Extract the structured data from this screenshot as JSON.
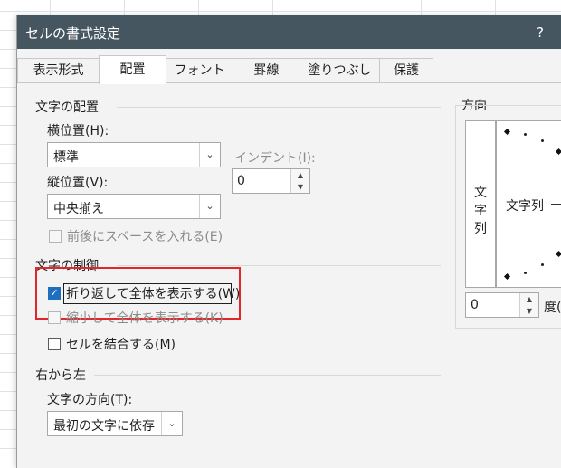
{
  "dialog": {
    "title": "セルの書式設定",
    "help": "?"
  },
  "tabs": [
    "表示形式",
    "配置",
    "フォント",
    "罫線",
    "塗りつぶし",
    "保護"
  ],
  "active_tab": "配置",
  "alignment": {
    "group_title": "文字の配置",
    "horizontal_label": "横位置(H):",
    "horizontal_value": "標準",
    "vertical_label": "縦位置(V):",
    "vertical_value": "中央揃え",
    "indent_label": "インデント(I):",
    "indent_value": "0",
    "justify_distributed": "前後にスペースを入れる(E)"
  },
  "text_control": {
    "group_title": "文字の制御",
    "wrap_text": "折り返して全体を表示する(W)",
    "wrap_text_checked": true,
    "shrink_to_fit": "縮小して全体を表示する(K)",
    "shrink_to_fit_checked": false,
    "merge_cells": "セルを結合する(M)",
    "merge_cells_checked": false
  },
  "rtl": {
    "group_title": "右から左",
    "direction_label": "文字の方向(T):",
    "direction_value": "最初の文字に依存"
  },
  "orientation": {
    "group_title": "方向",
    "vertical_text": [
      "文",
      "字",
      "列"
    ],
    "horizontal_text": "文字列",
    "degrees_value": "0",
    "degrees_unit": "度(D)"
  },
  "colors": {
    "titlebar": "#465660",
    "highlight": "#e0272b",
    "check_accent": "#1f6fc1"
  }
}
